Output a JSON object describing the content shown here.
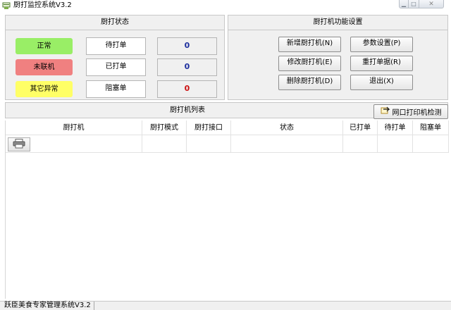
{
  "window": {
    "title": "厨打监控系统V3.2"
  },
  "status_panel": {
    "header": "厨打状态",
    "indicators": [
      {
        "label": "正常",
        "color": "#99ee66"
      },
      {
        "label": "未联机",
        "color": "#f08080"
      },
      {
        "label": "其它异常",
        "color": "#ffff66"
      }
    ],
    "counters": [
      {
        "label": "待打单",
        "value": "0",
        "color": "#1d2f9e"
      },
      {
        "label": "已打单",
        "value": "0",
        "color": "#1d2f9e"
      },
      {
        "label": "阻塞单",
        "value": "0",
        "color": "#cc1111"
      }
    ]
  },
  "function_panel": {
    "header": "厨打机功能设置",
    "buttons": {
      "add": "新增厨打机(N)",
      "edit": "修改厨打机(E)",
      "delete": "删除厨打机(D)",
      "params": "参数设置(P)",
      "reprint": "重打单据(R)",
      "exit": "退出(X)"
    }
  },
  "printer_list": {
    "title": "厨打机列表",
    "detect_button": "网口打印机检测",
    "columns": [
      "厨打机",
      "厨打模式",
      "厨打接口",
      "状态",
      "已打单",
      "待打单",
      "阻塞单"
    ]
  },
  "statusbar": {
    "text": "跃臣美食专家管理系统V3.2"
  }
}
